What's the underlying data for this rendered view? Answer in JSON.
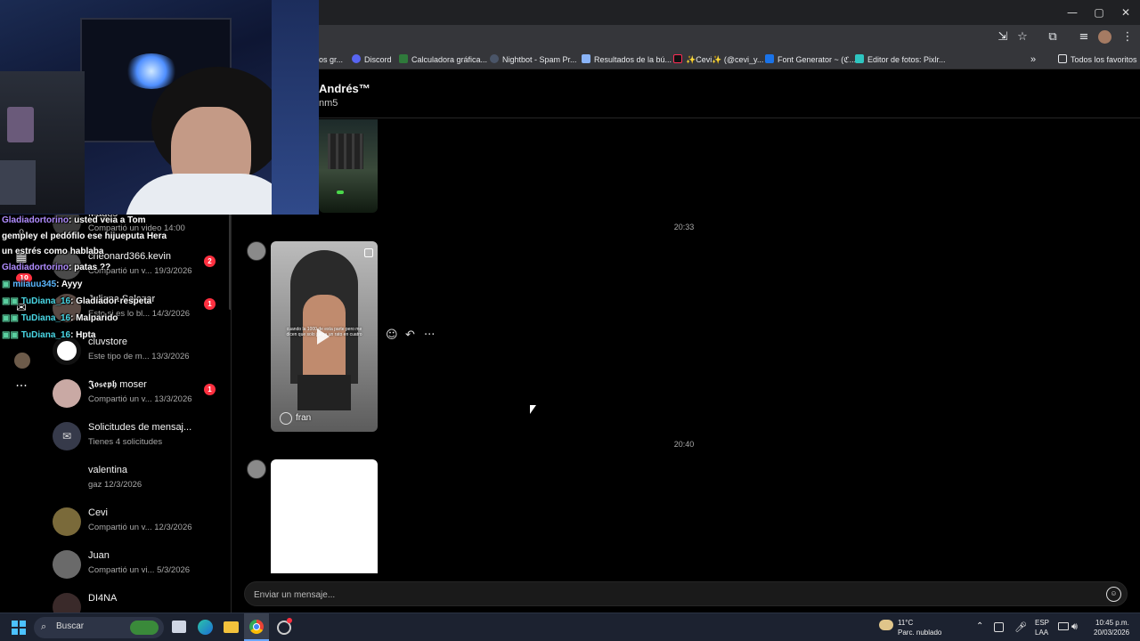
{
  "window": {
    "controls": {
      "minimize": "—",
      "maximize": "▢",
      "close": "✕"
    }
  },
  "bookmarks": {
    "items": [
      {
        "label": "os gr...",
        "icon": "folder-icon",
        "color": "#8ab4f8"
      },
      {
        "label": "Discord",
        "icon": "discord-icon",
        "color": "#5865f2"
      },
      {
        "label": "Calculadora gráfica...",
        "icon": "desmos-icon",
        "color": "#2f7a3b"
      },
      {
        "label": "Nightbot - Spam Pr...",
        "icon": "nightbot-icon",
        "color": "#4a5568"
      },
      {
        "label": "Resultados de la bú...",
        "icon": "page-icon",
        "color": "#8ab4f8"
      },
      {
        "label": "✨Cevi✨ (@cevi_y...",
        "icon": "tiktok-icon",
        "color": "#111111"
      },
      {
        "label": "Font Generator ~ (ℭ...",
        "icon": "font-icon",
        "color": "#1a73e8"
      },
      {
        "label": "Editor de fotos: Pixlr...",
        "icon": "pixlr-icon",
        "color": "#2ec5c0"
      }
    ],
    "more": "»",
    "all_bookmarks": "Todos los favoritos"
  },
  "conversations": [
    {
      "name": "Magos",
      "sub": "Compartió un video 14:00",
      "badge": ""
    },
    {
      "name": "crleonard366.kevin",
      "sub": "Compartió un v... 19/3/2026",
      "badge": "2"
    },
    {
      "name": "Juliana Salazar",
      "sub": "Esto si es lo bl... 14/3/2026",
      "badge": "1"
    },
    {
      "name": "cluvstore",
      "sub": "Este tipo de m... 13/3/2026",
      "badge": ""
    },
    {
      "name": "𝕵𝖔𝖘𝖊𝖕𝖍 moser",
      "sub": "Compartió un v... 13/3/2026",
      "badge": "1"
    },
    {
      "name": "Solicitudes de mensaj...",
      "sub": "Tienes 4 solicitudes",
      "badge": ""
    },
    {
      "name": "valentina",
      "sub": "gaz 12/3/2026",
      "badge": ""
    },
    {
      "name": "Cevi",
      "sub": "Compartió un v... 12/3/2026",
      "badge": ""
    },
    {
      "name": "Juan",
      "sub": "Compartió un vi... 5/3/2026",
      "badge": ""
    },
    {
      "name": "DI4NA",
      "sub": "",
      "badge": ""
    }
  ],
  "rail": {
    "notif_badge": "10",
    "more_icon": "···"
  },
  "chat": {
    "name": "Andrés™",
    "username": "nm5",
    "timestamps": [
      "20:33",
      "20:40"
    ],
    "reel": {
      "caption": "cuando la 1000 de esta parte pero me dicen que solo juega un rato en cuatro",
      "author": "fran"
    },
    "composer_placeholder": "Enviar un mensaje..."
  },
  "stream_chat": [
    {
      "user": "Gladiadortorino",
      "text": ": usted veia a Tom"
    },
    {
      "user": "",
      "text": "gempley el pedófilo ese hijueputa Hera"
    },
    {
      "user": "",
      "text": "un estrés como hablaba"
    },
    {
      "user": "Gladiadortorino",
      "text": ": patas ??"
    },
    {
      "user": "miiauu345",
      "text": ": Ayyy"
    },
    {
      "user": "TuDiana_16",
      "text": ": Gladiador respeta"
    },
    {
      "user": "TuDiana_16",
      "text": ": Malparido"
    },
    {
      "user": "TuDiana_16",
      "text": ": Hpta"
    }
  ],
  "taskbar": {
    "search": "Buscar",
    "weather_temp": "11°C",
    "weather_desc": "Parc. nublado",
    "lang": "ESP",
    "lang2": "LAA",
    "time": "10:45 p.m.",
    "date": "20/03/2026"
  }
}
